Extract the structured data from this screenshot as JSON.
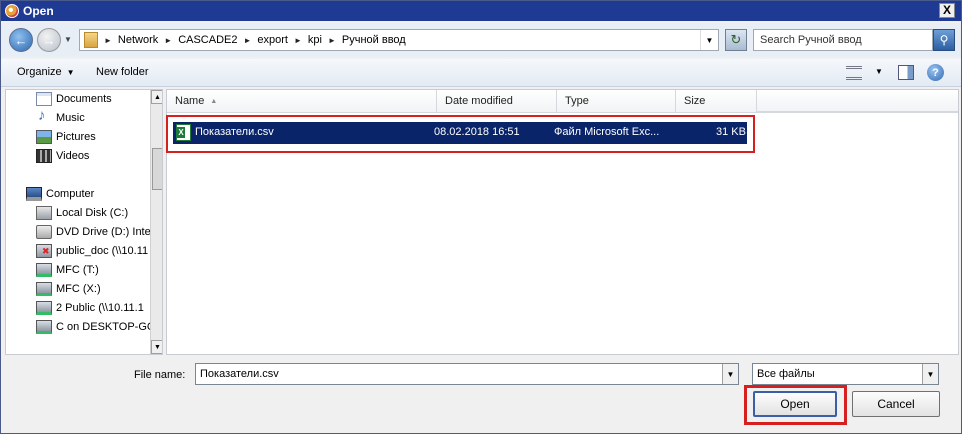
{
  "window": {
    "title": "Open",
    "close_label": "X"
  },
  "address_bar": {
    "crumbs": [
      "Network",
      "CASCADE2",
      "export",
      "kpi",
      "Ручной ввод"
    ],
    "search_placeholder": "Search Ручной ввод"
  },
  "toolbar": {
    "organize_label": "Organize",
    "new_folder_label": "New folder",
    "help_label": "?"
  },
  "nav_pane": {
    "items": [
      {
        "label": "Documents",
        "icon": "documents-icon"
      },
      {
        "label": "Music",
        "icon": "music-icon"
      },
      {
        "label": "Pictures",
        "icon": "pictures-icon"
      },
      {
        "label": "Videos",
        "icon": "videos-icon"
      },
      {
        "label": "Computer",
        "icon": "computer-icon"
      },
      {
        "label": "Local Disk (C:)",
        "icon": "local-disk-icon"
      },
      {
        "label": "DVD Drive (D:) Inte",
        "icon": "dvd-drive-icon"
      },
      {
        "label": "public_doc (\\\\10.11",
        "icon": "network-drive-disconnected-icon"
      },
      {
        "label": "MFC (T:)",
        "icon": "network-drive-icon"
      },
      {
        "label": "MFC (X:)",
        "icon": "network-drive-icon"
      },
      {
        "label": "2 Public (\\\\10.11.1",
        "icon": "network-drive-icon"
      },
      {
        "label": "C on DESKTOP-GCF",
        "icon": "network-drive-icon"
      }
    ]
  },
  "file_list": {
    "columns": [
      "Name",
      "Date modified",
      "Type",
      "Size"
    ],
    "rows": [
      {
        "name": "Показатели.csv",
        "date_modified": "08.02.2018 16:51",
        "type": "Файл Microsoft Exc...",
        "size": "31 KB",
        "selected": true
      }
    ]
  },
  "bottom": {
    "file_name_label": "File name:",
    "file_name_value": "Показатели.csv",
    "file_type_value": "Все файлы",
    "open_label": "Open",
    "cancel_label": "Cancel"
  },
  "colors": {
    "selection": "#0a246a",
    "highlight_box": "#d62020",
    "titlebar": "#1f3a93"
  }
}
